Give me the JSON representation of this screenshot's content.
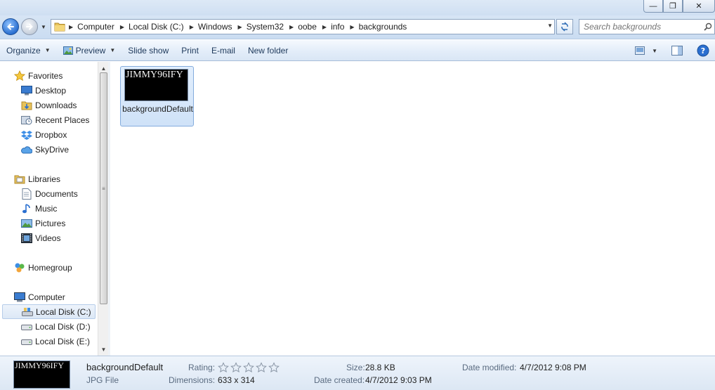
{
  "window": {
    "minimize_glyph": "—",
    "maximize_glyph": "❐",
    "close_glyph": "✕"
  },
  "address_bar": {
    "crumbs": [
      "Computer",
      "Local Disk (C:)",
      "Windows",
      "System32",
      "oobe",
      "info",
      "backgrounds"
    ]
  },
  "search": {
    "placeholder": "Search backgrounds"
  },
  "toolbar": {
    "organize": "Organize",
    "preview": "Preview",
    "slideshow": "Slide show",
    "print": "Print",
    "email": "E-mail",
    "new_folder": "New folder"
  },
  "nav": {
    "favorites": "Favorites",
    "desktop": "Desktop",
    "downloads": "Downloads",
    "recent_places": "Recent Places",
    "dropbox": "Dropbox",
    "skydrive": "SkyDrive",
    "libraries": "Libraries",
    "documents": "Documents",
    "music": "Music",
    "pictures": "Pictures",
    "videos": "Videos",
    "homegroup": "Homegroup",
    "computer": "Computer",
    "disk_c": "Local Disk (C:)",
    "disk_d": "Local Disk (D:)",
    "disk_e": "Local Disk (E:)"
  },
  "files": [
    {
      "name": "backgroundDefault",
      "thumb_text": "JIMMY96IFY"
    }
  ],
  "details": {
    "thumb_text": "JIMMY96IFY",
    "name": "backgroundDefault",
    "type": "JPG File",
    "rating_label": "Rating:",
    "rating_stars": 0,
    "dimensions_label": "Dimensions:",
    "dimensions": "633 x 314",
    "size_label": "Size:",
    "size": "28.8 KB",
    "date_created_label": "Date created:",
    "date_created": "4/7/2012 9:03 PM",
    "date_modified_label": "Date modified:",
    "date_modified": "4/7/2012 9:08 PM"
  },
  "colors": {
    "accent": "#2a6fd0",
    "selection": "#cfe2f8",
    "selection_border": "#84acdd"
  }
}
